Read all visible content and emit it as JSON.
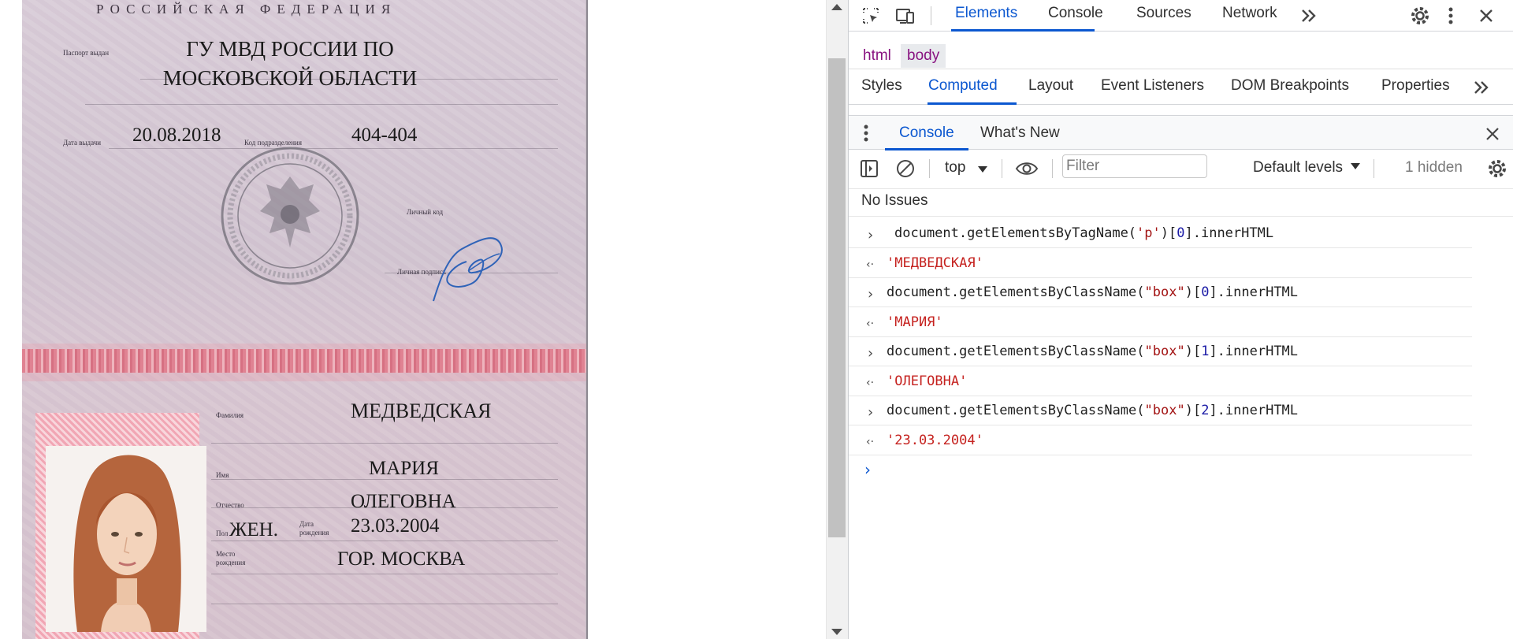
{
  "passport": {
    "header": "РОССИЙСКАЯ ФЕДЕРАЦИЯ",
    "issued_by_label": "Паспорт выдан",
    "issuer": "ГУ МВД РОССИИ ПО МОСКОВСКОЙ ОБЛАСТИ",
    "issue_date_label": "Дата выдачи",
    "issue_date": "20.08.2018",
    "code_label": "Код подразделения",
    "code": "404-404",
    "personal_code_label": "Личный код",
    "signature_label": "Личная подпись",
    "surname_label": "Фамилия",
    "surname": "МЕДВЕДСКАЯ",
    "name_label": "Имя",
    "name": "МАРИЯ",
    "patronymic_label": "Отчество",
    "patronymic": "ОЛЕГОВНА",
    "sex_label": "Пол",
    "sex": "ЖЕН.",
    "dob_label": "Дата рождения",
    "dob": "23.03.2004",
    "birthplace_label": "Место рождения",
    "birthplace": "ГОР. МОСКВА"
  },
  "devtools": {
    "main_tabs": [
      "Elements",
      "Console",
      "Sources",
      "Network"
    ],
    "active_main_tab": "Elements",
    "breadcrumbs": [
      "html",
      "body"
    ],
    "sub_tabs": [
      "Styles",
      "Computed",
      "Layout",
      "Event Listeners",
      "DOM Breakpoints",
      "Properties"
    ],
    "active_sub_tab": "Computed",
    "drawer_tabs": [
      "Console",
      "What's New"
    ],
    "active_drawer_tab": "Console",
    "toolbar": {
      "context": "top",
      "filter_placeholder": "Filter",
      "levels": "Default levels",
      "hidden": "1 hidden"
    },
    "issues": "No Issues",
    "console_entries": [
      {
        "type": "input",
        "parts": [
          [
            "document.getElementsByTagName(",
            ""
          ],
          [
            "'p'",
            "str"
          ],
          [
            ")[",
            ""
          ],
          [
            "0",
            "num"
          ],
          [
            "].innerHTML",
            ""
          ]
        ]
      },
      {
        "type": "output",
        "text": "'МЕДВЕДСКАЯ'"
      },
      {
        "type": "input",
        "parts": [
          [
            "document.getElementsByClassName(",
            ""
          ],
          [
            "\"box\"",
            "str"
          ],
          [
            ")[",
            ""
          ],
          [
            "0",
            "num"
          ],
          [
            "].innerHTML",
            ""
          ]
        ]
      },
      {
        "type": "output",
        "text": "'МАРИЯ'"
      },
      {
        "type": "input",
        "parts": [
          [
            "document.getElementsByClassName(",
            ""
          ],
          [
            "\"box\"",
            "str"
          ],
          [
            ")[",
            ""
          ],
          [
            "1",
            "num"
          ],
          [
            "].innerHTML",
            ""
          ]
        ]
      },
      {
        "type": "output",
        "text": "'ОЛЕГОВНА'"
      },
      {
        "type": "input",
        "parts": [
          [
            "document.getElementsByClassName(",
            ""
          ],
          [
            "\"box\"",
            "str"
          ],
          [
            ")[",
            ""
          ],
          [
            "2",
            "num"
          ],
          [
            "].innerHTML",
            ""
          ]
        ]
      },
      {
        "type": "output",
        "text": "'23.03.2004'"
      }
    ],
    "colors": {
      "accent": "#0b57d0",
      "result_string": "#c5221f",
      "tag": "#881280"
    },
    "icons": [
      "inspect-element-icon",
      "device-toolbar-icon",
      "more-tabs-icon",
      "settings-icon",
      "kebab-menu-icon",
      "close-icon",
      "drawer-menu-icon",
      "sidebar-toggle-icon",
      "clear-console-icon",
      "dropdown-caret-icon",
      "eye-icon",
      "console-settings-icon",
      "prompt-caret-icon"
    ]
  }
}
